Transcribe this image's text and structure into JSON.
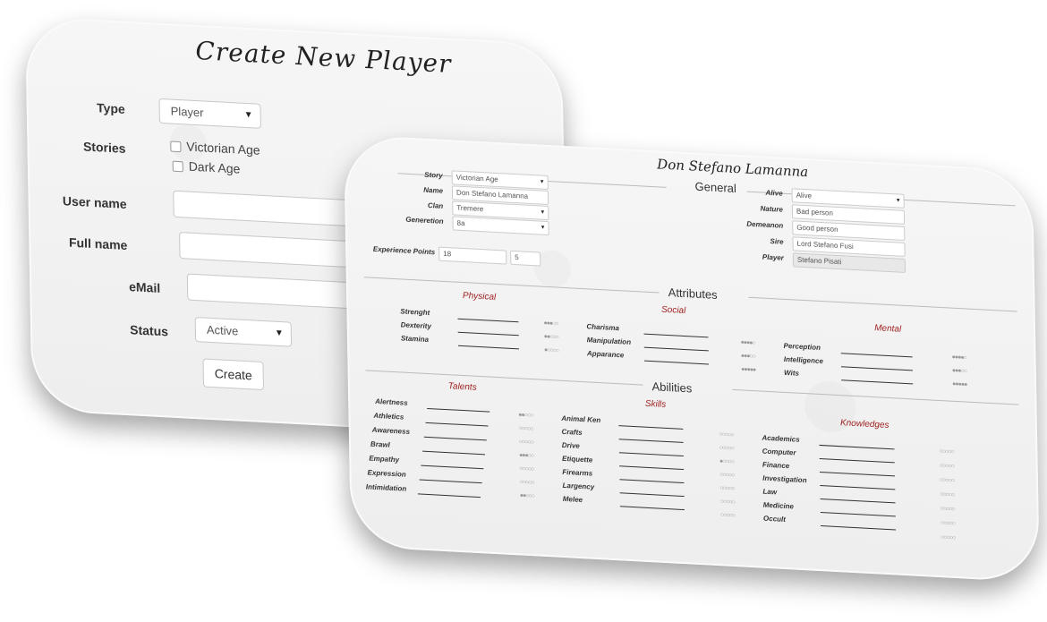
{
  "create_form": {
    "title": "Create New Player",
    "type_label": "Type",
    "type_value": "Player",
    "stories_label": "Stories",
    "stories": [
      "Victorian Age",
      "Dark Age"
    ],
    "username_label": "User name",
    "fullname_label": "Full name",
    "email_label": "eMail",
    "status_label": "Status",
    "status_value": "Active",
    "create_button": "Create"
  },
  "sheet": {
    "title": "Don Stefano Lamanna",
    "general_heading": "General",
    "general_left": [
      {
        "label": "Story",
        "value": "Victorian Age",
        "kind": "select"
      },
      {
        "label": "Name",
        "value": "Don Stefano Lamanna",
        "kind": "text"
      },
      {
        "label": "Clan",
        "value": "Tremere",
        "kind": "select"
      },
      {
        "label": "Generetion",
        "value": "8a",
        "kind": "select"
      }
    ],
    "experience_label": "Experience Points",
    "experience_values": [
      "18",
      "5"
    ],
    "general_right": [
      {
        "label": "Alive",
        "value": "Alive",
        "kind": "select"
      },
      {
        "label": "Nature",
        "value": "Bad person",
        "kind": "text"
      },
      {
        "label": "Demeanon",
        "value": "Good person",
        "kind": "text"
      },
      {
        "label": "Sire",
        "value": "Lord Stefano Fusi",
        "kind": "text"
      },
      {
        "label": "Player",
        "value": "Stefano Pisati",
        "kind": "readonly"
      }
    ],
    "attributes_heading": "Attributes",
    "physical_label": "Physical",
    "social_label": "Social",
    "mental_label": "Mental",
    "physical": [
      {
        "name": "Strenght",
        "rating": 0
      },
      {
        "name": "Dexterity",
        "rating": 0
      },
      {
        "name": "Stamina",
        "rating": 0
      }
    ],
    "social": [
      {
        "name": "Charisma",
        "rating": 3
      },
      {
        "name": "Manipulation",
        "rating": 2
      },
      {
        "name": "Apparance",
        "rating": 1
      }
    ],
    "mental": [
      {
        "name": "Perception",
        "rating": 4
      },
      {
        "name": "Intelligence",
        "rating": 3
      },
      {
        "name": "Wits",
        "rating": 5
      }
    ],
    "mental_extra_ratings": [
      4,
      3,
      5
    ],
    "abilities_heading": "Abilities",
    "talents_label": "Talents",
    "skills_label": "Skills",
    "knowledges_label": "Knowledges",
    "talents": [
      "Alertness",
      "Athletics",
      "Awareness",
      "Brawl",
      "Empathy",
      "Expression",
      "Intimidation"
    ],
    "skills": [
      {
        "name": "Animal Ken",
        "rating": 2
      },
      {
        "name": "Crafts",
        "rating": 0
      },
      {
        "name": "Drive",
        "rating": 0
      },
      {
        "name": "Etiquette",
        "rating": 3
      },
      {
        "name": "Firearms",
        "rating": 0
      },
      {
        "name": "Largency",
        "rating": 0
      },
      {
        "name": "Melee",
        "rating": 2
      }
    ],
    "knowledges": [
      {
        "name": "Academics",
        "rating": 0
      },
      {
        "name": "Computer",
        "rating": 0
      },
      {
        "name": "Finance",
        "rating": 1
      },
      {
        "name": "Investigation",
        "rating": 0
      },
      {
        "name": "Law",
        "rating": 0
      },
      {
        "name": "Medicine",
        "rating": 0
      },
      {
        "name": "Occult",
        "rating": 0
      }
    ],
    "knowledges_extra_ratings": [
      0,
      0,
      0,
      0,
      0,
      0,
      0
    ]
  }
}
